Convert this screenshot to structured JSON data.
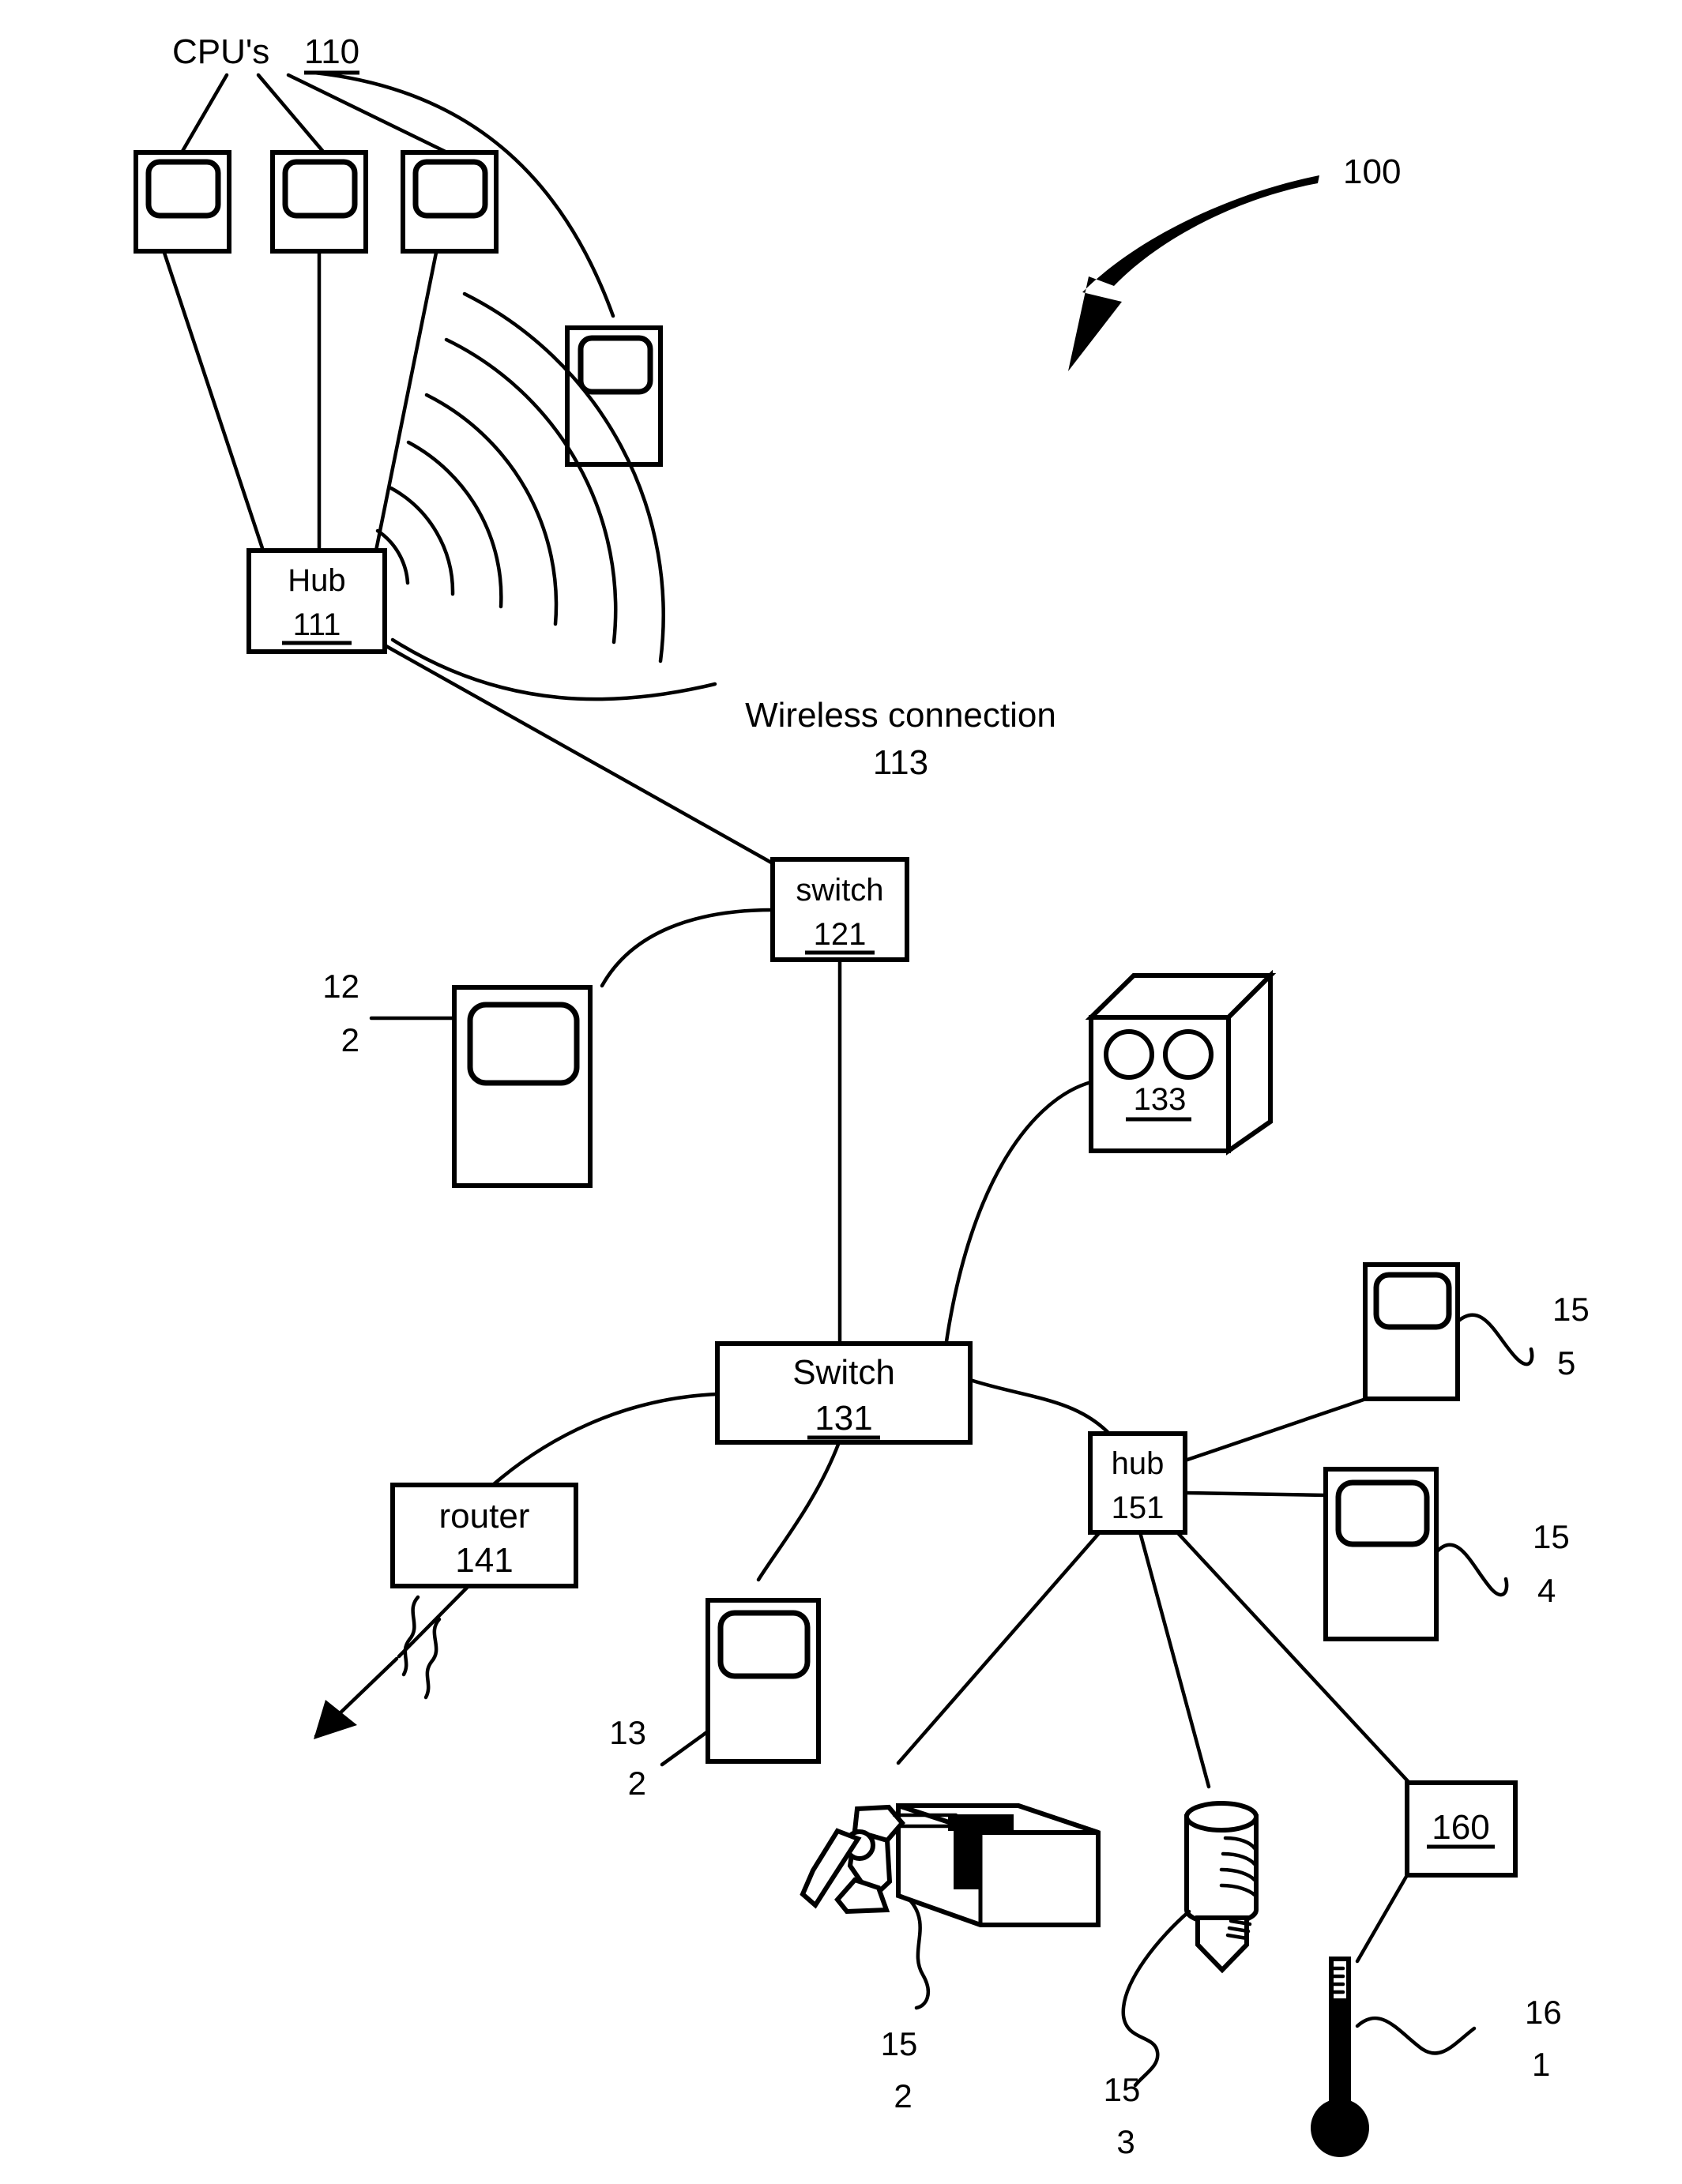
{
  "figure": {
    "title": "Network system diagram",
    "reference_numeral": "100",
    "accent_color": "#000000",
    "background_color": "#ffffff"
  },
  "labels": {
    "cpus_group": "CPU's 110",
    "cpus_group_text": "CPU's",
    "cpus_group_number": "110",
    "figure_number": "100",
    "hub_111_name": "Hub",
    "hub_111_number": "111",
    "wireless_connection_text": "Wireless connection",
    "wireless_connection_number": "113",
    "switch_121_name": "switch",
    "switch_121_number": "121",
    "computer_122_line1": "12",
    "computer_122_line2": "2",
    "device_133_number": "133",
    "switch_131_name": "Switch",
    "switch_131_number": "131",
    "router_141_name": "router",
    "router_141_number": "141",
    "computer_132_line1": "13",
    "computer_132_line2": "2",
    "hub_151_name": "hub",
    "hub_151_number": "151",
    "computer_155_line1": "15",
    "computer_155_line2": "5",
    "computer_154_line1": "15",
    "computer_154_line2": "4",
    "robot_152_line1": "15",
    "robot_152_line2": "2",
    "drill_153_line1": "15",
    "drill_153_line2": "3",
    "box_160_number": "160",
    "thermometer_161_line1": "16",
    "thermometer_161_line2": "1"
  },
  "nodes": [
    {
      "id": "cpu-1",
      "kind": "computer",
      "label": "",
      "number": "110"
    },
    {
      "id": "cpu-2",
      "kind": "computer",
      "label": "",
      "number": "110"
    },
    {
      "id": "cpu-3",
      "kind": "computer",
      "label": "",
      "number": "110"
    },
    {
      "id": "cpu-wireless",
      "kind": "computer",
      "label": "",
      "number": "110"
    },
    {
      "id": "hub-111",
      "kind": "hub",
      "label": "Hub",
      "number": "111"
    },
    {
      "id": "switch-121",
      "kind": "switch",
      "label": "switch",
      "number": "121"
    },
    {
      "id": "computer-122",
      "kind": "computer",
      "label": "",
      "number": "122"
    },
    {
      "id": "device-133",
      "kind": "sensor-box",
      "label": "",
      "number": "133"
    },
    {
      "id": "switch-131",
      "kind": "switch",
      "label": "Switch",
      "number": "131"
    },
    {
      "id": "router-141",
      "kind": "router",
      "label": "router",
      "number": "141"
    },
    {
      "id": "computer-132",
      "kind": "computer",
      "label": "",
      "number": "132"
    },
    {
      "id": "hub-151",
      "kind": "hub",
      "label": "hub",
      "number": "151"
    },
    {
      "id": "computer-155",
      "kind": "computer",
      "label": "",
      "number": "155"
    },
    {
      "id": "computer-154",
      "kind": "computer",
      "label": "",
      "number": "154"
    },
    {
      "id": "robot-152",
      "kind": "robot-arm",
      "label": "",
      "number": "152"
    },
    {
      "id": "drill-153",
      "kind": "drill-tool",
      "label": "",
      "number": "153"
    },
    {
      "id": "box-160",
      "kind": "plain-box",
      "label": "",
      "number": "160"
    },
    {
      "id": "thermometer-161",
      "kind": "thermometer",
      "label": "",
      "number": "161"
    }
  ],
  "connections": [
    {
      "from": "cpu-1",
      "to": "hub-111",
      "style": "solid"
    },
    {
      "from": "cpu-2",
      "to": "hub-111",
      "style": "solid"
    },
    {
      "from": "cpu-3",
      "to": "hub-111",
      "style": "solid"
    },
    {
      "from": "cpu-wireless",
      "to": "hub-111",
      "style": "wireless",
      "number": "113"
    },
    {
      "from": "hub-111",
      "to": "switch-121",
      "style": "solid"
    },
    {
      "from": "switch-121",
      "to": "computer-122",
      "style": "curve"
    },
    {
      "from": "switch-121",
      "to": "switch-131",
      "style": "solid"
    },
    {
      "from": "switch-131",
      "to": "device-133",
      "style": "curve"
    },
    {
      "from": "switch-131",
      "to": "router-141",
      "style": "curve"
    },
    {
      "from": "switch-131",
      "to": "computer-132",
      "style": "curve"
    },
    {
      "from": "switch-131",
      "to": "hub-151",
      "style": "curve"
    },
    {
      "from": "hub-151",
      "to": "computer-155",
      "style": "solid"
    },
    {
      "from": "hub-151",
      "to": "computer-154",
      "style": "solid"
    },
    {
      "from": "hub-151",
      "to": "robot-152",
      "style": "solid"
    },
    {
      "from": "hub-151",
      "to": "drill-153",
      "style": "solid"
    },
    {
      "from": "hub-151",
      "to": "box-160",
      "style": "solid"
    },
    {
      "from": "box-160",
      "to": "thermometer-161",
      "style": "solid"
    },
    {
      "from": "router-141",
      "to": "external-network",
      "style": "broken-arrow"
    }
  ]
}
